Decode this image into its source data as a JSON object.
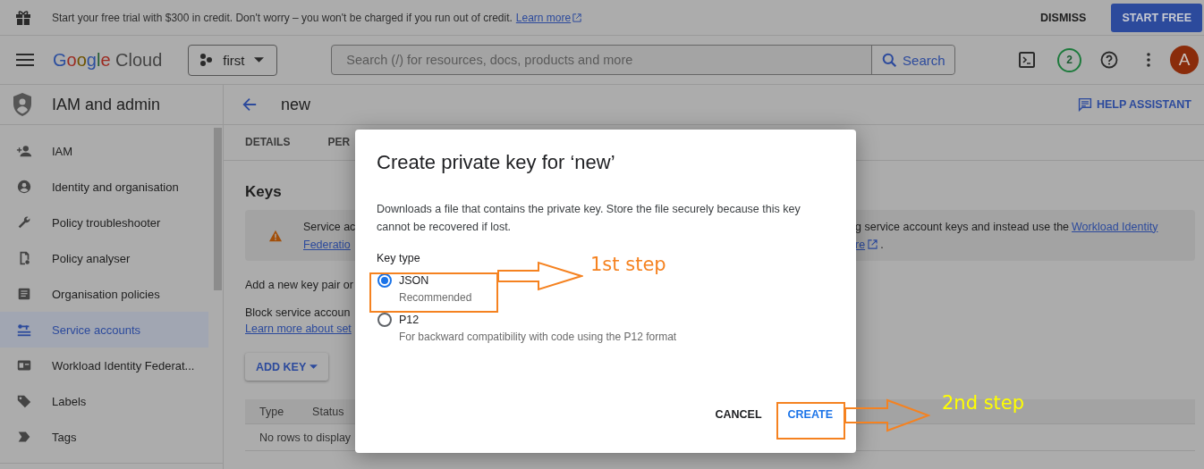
{
  "banner": {
    "text": "Start your free trial with $300 in credit. Don't worry – you won't be charged if you run out of credit.",
    "link": "Learn more",
    "dismiss": "DISMISS",
    "start": "START FREE"
  },
  "header": {
    "logo_google": "Google",
    "logo_cloud": "Cloud",
    "project": "first",
    "search_placeholder": "Search (/) for resources, docs, products and more",
    "search_button": "Search",
    "notifications": "2",
    "avatar": "A"
  },
  "sidebar": {
    "title": "IAM and admin",
    "items": [
      {
        "label": "IAM",
        "selected": false
      },
      {
        "label": "Identity and organisation",
        "selected": false
      },
      {
        "label": "Policy troubleshooter",
        "selected": false
      },
      {
        "label": "Policy analyser",
        "selected": false
      },
      {
        "label": "Organisation policies",
        "selected": false
      },
      {
        "label": "Service accounts",
        "selected": true
      },
      {
        "label": "Workload Identity Federat...",
        "selected": false
      },
      {
        "label": "Labels",
        "selected": false
      },
      {
        "label": "Tags",
        "selected": false
      }
    ]
  },
  "page": {
    "title": "new",
    "help": "HELP ASSISTANT",
    "tabs": [
      {
        "label": "DETAILS",
        "selected": false
      },
      {
        "label": "PER",
        "selected": false
      }
    ],
    "heading": "Keys",
    "warning": {
      "left_line": "Service ac",
      "left_link": "Federatio",
      "right_line": "g service account keys and instead use the",
      "right_link": "Workload Identity",
      "right_link_2": "re",
      "right_end": "."
    },
    "add_text": "Add a new key pair or",
    "block_text": "Block service accoun",
    "learn_link": "Learn more about set",
    "add_key": "ADD KEY",
    "table": {
      "columns": [
        "Type",
        "Status"
      ],
      "empty": "No rows to display"
    }
  },
  "dialog": {
    "title": "Create private key for ‘new’",
    "description": "Downloads a file that contains the private key. Store the file securely because this key cannot be recovered if lost.",
    "key_type_label": "Key type",
    "options": [
      {
        "label": "JSON",
        "hint": "Recommended",
        "selected": true
      },
      {
        "label": "P12",
        "hint": "For backward compatibility with code using the P12 format",
        "selected": false
      }
    ],
    "cancel": "CANCEL",
    "create": "CREATE"
  },
  "annotations": [
    {
      "text": "1st step",
      "color": "#f58220"
    },
    {
      "text": "2nd step",
      "color": "#ffff00"
    }
  ]
}
